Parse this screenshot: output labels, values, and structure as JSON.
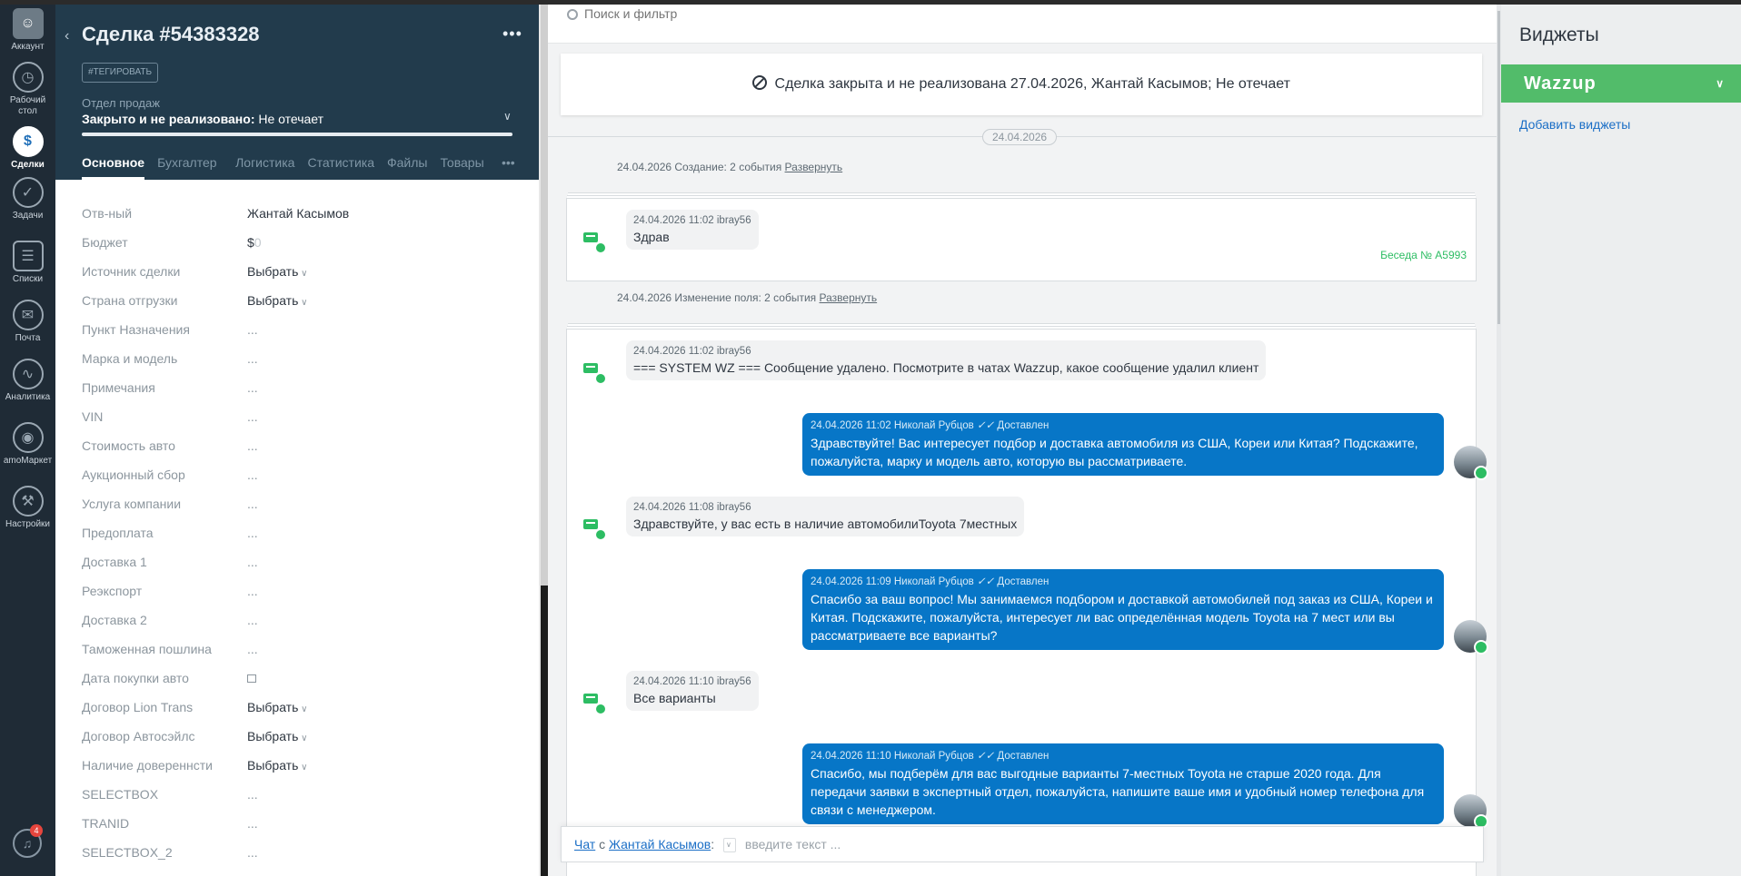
{
  "nav": {
    "items": [
      {
        "label": "Аккаунт",
        "icon": "account-icon"
      },
      {
        "label": "Рабочий стол",
        "icon": "dashboard-icon"
      },
      {
        "label": "Сделки",
        "icon": "deals-icon"
      },
      {
        "label": "Задачи",
        "icon": "tasks-icon"
      },
      {
        "label": "Списки",
        "icon": "lists-icon"
      },
      {
        "label": "Почта",
        "icon": "mail-icon"
      },
      {
        "label": "Аналитика",
        "icon": "analytics-icon"
      },
      {
        "label": "amoМаркет",
        "icon": "market-icon"
      },
      {
        "label": "Настройки",
        "icon": "settings-icon"
      }
    ],
    "notifications_count": "4"
  },
  "deal": {
    "title": "Сделка #54383328",
    "tag_button": "#ТЕГИРОВАТЬ",
    "pipeline": "Отдел продаж",
    "stage_prefix": "Закрыто и не реализовано:",
    "stage_reason": "Не отечает",
    "tabs": [
      "Основное",
      "Бухгалтер",
      "Логистика",
      "Статистика",
      "Файлы",
      "Товары"
    ],
    "fields": [
      {
        "label": "Отв-ный",
        "value": "Жантай Касымов"
      },
      {
        "label": "Бюджет",
        "value": "$"
      },
      {
        "label": "Источник сделки",
        "value": "Выбрать"
      },
      {
        "label": "Страна отгрузки",
        "value": "Выбрать"
      },
      {
        "label": "Пункт Назначения",
        "value": "..."
      },
      {
        "label": "Марка и модель",
        "value": "..."
      },
      {
        "label": "Примечания",
        "value": "..."
      },
      {
        "label": "VIN",
        "value": "..."
      },
      {
        "label": "Стоимость авто",
        "value": "..."
      },
      {
        "label": "Аукционный сбор",
        "value": "..."
      },
      {
        "label": "Услуга компании",
        "value": "..."
      },
      {
        "label": "Предоплата",
        "value": "..."
      },
      {
        "label": "Доставка 1",
        "value": "..."
      },
      {
        "label": "Реэкспорт",
        "value": "..."
      },
      {
        "label": "Доставка 2",
        "value": "..."
      },
      {
        "label": "Таможенная пошлина",
        "value": "..."
      },
      {
        "label": "Дата покупки авто",
        "value": ""
      },
      {
        "label": "Договор Lion Trans",
        "value": "Выбрать"
      },
      {
        "label": "Договор Автосэйлс",
        "value": "Выбрать"
      },
      {
        "label": "Наличие довереннсти",
        "value": "Выбрать"
      },
      {
        "label": "SELECTBOX",
        "value": "..."
      },
      {
        "label": "TRANID",
        "value": "..."
      },
      {
        "label": "SELECTBOX_2",
        "value": "..."
      }
    ],
    "budget_zero": "0"
  },
  "feed": {
    "search_placeholder": "Поиск и фильтр",
    "closed_banner": "Сделка закрыта и не реализована 27.04.2026, Жантай Касымов; Не отечает",
    "date_pill": "24.04.2026",
    "note1": "24.04.2026 Создание: 2 события",
    "note2": "24.04.2026 Изменение поля: 2 события",
    "expand_label": "Развернуть",
    "conversation": "Беседа № A5993",
    "messages": [
      {
        "meta": "24.04.2026 11:02 ibray56",
        "text": "Здрав"
      },
      {
        "meta": "24.04.2026 11:02 ibray56",
        "text": "=== SYSTEM WZ === Сообщение удалено. Посмотрите в чатах Wazzup, какое сообщение удалил клиент"
      },
      {
        "meta": "24.04.2026 11:02 Николай Рубцов",
        "status": "Доставлен",
        "text": "Здравствуйте! Вас интересует подбор и доставка автомобиля из США, Кореи или Китая? Подскажите, пожалуйста, марку и модель авто, которую вы рассматриваете."
      },
      {
        "meta": "24.04.2026 11:08 ibray56",
        "text": "Здравствуйте, у вас есть в наличие автомобилиToyota 7местных"
      },
      {
        "meta": "24.04.2026 11:09 Николай Рубцов",
        "status": "Доставлен",
        "text": "Спасибо за ваш вопрос! Мы занимаемся подбором и доставкой автомобилей под заказ из США, Кореи и Китая. Подскажите, пожалуйста, интересует ли вас определённая модель Toyota на 7 мест или вы рассматриваете все варианты?"
      },
      {
        "meta": "24.04.2026 11:10 ibray56",
        "text": "Все варианты"
      },
      {
        "meta": "24.04.2026 11:10 Николай Рубцов",
        "status": "Доставлен",
        "text": "Спасибо, мы подберём для вас выгодные варианты 7-местных Toyota не старше 2020 года. Для передачи заявки в экспертный отдел, пожалуйста, напишите ваше имя и удобный номер телефона для связи с менеджером."
      }
    ],
    "compose": {
      "chat_link": "Чат",
      "with": "с",
      "contact_link": "Жантай Касымов",
      "colon": ":",
      "placeholder": "введите текст ..."
    }
  },
  "widgets": {
    "title": "Виджеты",
    "wazzup": "Wazzup",
    "add_link": "Добавить виджеты"
  },
  "colors": {
    "nav_bg": "#1f2b36",
    "deal_header_bg": "#223b4c",
    "outgoing_bubble": "#0776c7",
    "wazzup_green": "#52bc6a",
    "link_blue": "#1a6ec6"
  }
}
